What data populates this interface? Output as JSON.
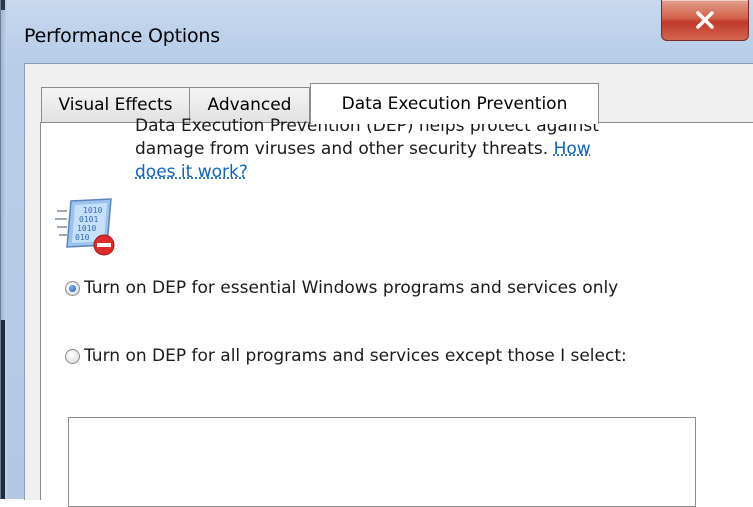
{
  "window": {
    "title": "Performance Options"
  },
  "tabs": [
    {
      "label": "Visual Effects"
    },
    {
      "label": "Advanced"
    },
    {
      "label": "Data Execution Prevention"
    }
  ],
  "dep": {
    "icon": "dep-shield-icon",
    "description": "Data Execution Prevention (DEP) helps protect against damage from viruses and other security threats.",
    "help_link": "How does it work?"
  },
  "options": [
    {
      "label": "Turn on DEP for essential Windows programs and services only",
      "selected": true
    },
    {
      "label": "Turn on DEP for all programs and services except those I select:",
      "selected": false
    }
  ],
  "colors": {
    "link": "#0b63c5",
    "close_button": "#c0392b"
  }
}
